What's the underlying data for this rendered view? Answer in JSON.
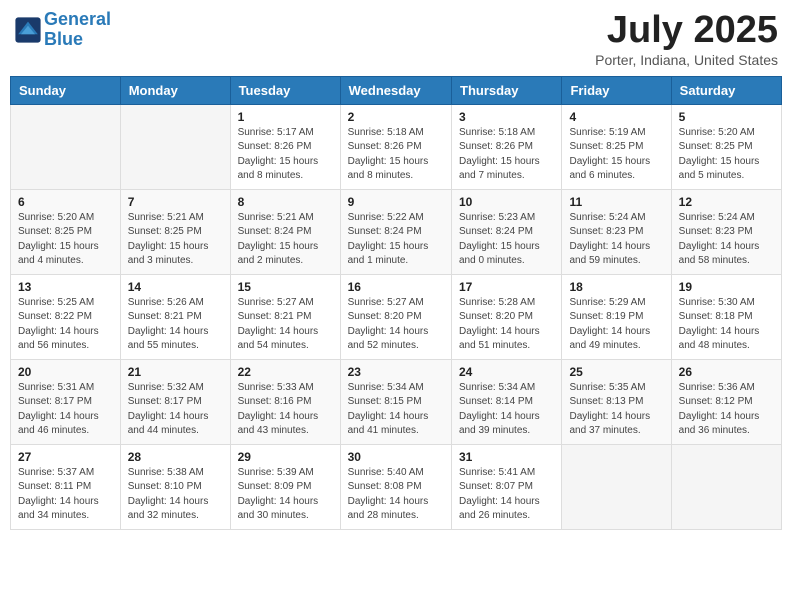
{
  "logo": {
    "line1": "General",
    "line2": "Blue"
  },
  "title": "July 2025",
  "location": "Porter, Indiana, United States",
  "weekdays": [
    "Sunday",
    "Monday",
    "Tuesday",
    "Wednesday",
    "Thursday",
    "Friday",
    "Saturday"
  ],
  "weeks": [
    [
      {
        "day": "",
        "info": ""
      },
      {
        "day": "",
        "info": ""
      },
      {
        "day": "1",
        "info": "Sunrise: 5:17 AM\nSunset: 8:26 PM\nDaylight: 15 hours\nand 8 minutes."
      },
      {
        "day": "2",
        "info": "Sunrise: 5:18 AM\nSunset: 8:26 PM\nDaylight: 15 hours\nand 8 minutes."
      },
      {
        "day": "3",
        "info": "Sunrise: 5:18 AM\nSunset: 8:26 PM\nDaylight: 15 hours\nand 7 minutes."
      },
      {
        "day": "4",
        "info": "Sunrise: 5:19 AM\nSunset: 8:25 PM\nDaylight: 15 hours\nand 6 minutes."
      },
      {
        "day": "5",
        "info": "Sunrise: 5:20 AM\nSunset: 8:25 PM\nDaylight: 15 hours\nand 5 minutes."
      }
    ],
    [
      {
        "day": "6",
        "info": "Sunrise: 5:20 AM\nSunset: 8:25 PM\nDaylight: 15 hours\nand 4 minutes."
      },
      {
        "day": "7",
        "info": "Sunrise: 5:21 AM\nSunset: 8:25 PM\nDaylight: 15 hours\nand 3 minutes."
      },
      {
        "day": "8",
        "info": "Sunrise: 5:21 AM\nSunset: 8:24 PM\nDaylight: 15 hours\nand 2 minutes."
      },
      {
        "day": "9",
        "info": "Sunrise: 5:22 AM\nSunset: 8:24 PM\nDaylight: 15 hours\nand 1 minute."
      },
      {
        "day": "10",
        "info": "Sunrise: 5:23 AM\nSunset: 8:24 PM\nDaylight: 15 hours\nand 0 minutes."
      },
      {
        "day": "11",
        "info": "Sunrise: 5:24 AM\nSunset: 8:23 PM\nDaylight: 14 hours\nand 59 minutes."
      },
      {
        "day": "12",
        "info": "Sunrise: 5:24 AM\nSunset: 8:23 PM\nDaylight: 14 hours\nand 58 minutes."
      }
    ],
    [
      {
        "day": "13",
        "info": "Sunrise: 5:25 AM\nSunset: 8:22 PM\nDaylight: 14 hours\nand 56 minutes."
      },
      {
        "day": "14",
        "info": "Sunrise: 5:26 AM\nSunset: 8:21 PM\nDaylight: 14 hours\nand 55 minutes."
      },
      {
        "day": "15",
        "info": "Sunrise: 5:27 AM\nSunset: 8:21 PM\nDaylight: 14 hours\nand 54 minutes."
      },
      {
        "day": "16",
        "info": "Sunrise: 5:27 AM\nSunset: 8:20 PM\nDaylight: 14 hours\nand 52 minutes."
      },
      {
        "day": "17",
        "info": "Sunrise: 5:28 AM\nSunset: 8:20 PM\nDaylight: 14 hours\nand 51 minutes."
      },
      {
        "day": "18",
        "info": "Sunrise: 5:29 AM\nSunset: 8:19 PM\nDaylight: 14 hours\nand 49 minutes."
      },
      {
        "day": "19",
        "info": "Sunrise: 5:30 AM\nSunset: 8:18 PM\nDaylight: 14 hours\nand 48 minutes."
      }
    ],
    [
      {
        "day": "20",
        "info": "Sunrise: 5:31 AM\nSunset: 8:17 PM\nDaylight: 14 hours\nand 46 minutes."
      },
      {
        "day": "21",
        "info": "Sunrise: 5:32 AM\nSunset: 8:17 PM\nDaylight: 14 hours\nand 44 minutes."
      },
      {
        "day": "22",
        "info": "Sunrise: 5:33 AM\nSunset: 8:16 PM\nDaylight: 14 hours\nand 43 minutes."
      },
      {
        "day": "23",
        "info": "Sunrise: 5:34 AM\nSunset: 8:15 PM\nDaylight: 14 hours\nand 41 minutes."
      },
      {
        "day": "24",
        "info": "Sunrise: 5:34 AM\nSunset: 8:14 PM\nDaylight: 14 hours\nand 39 minutes."
      },
      {
        "day": "25",
        "info": "Sunrise: 5:35 AM\nSunset: 8:13 PM\nDaylight: 14 hours\nand 37 minutes."
      },
      {
        "day": "26",
        "info": "Sunrise: 5:36 AM\nSunset: 8:12 PM\nDaylight: 14 hours\nand 36 minutes."
      }
    ],
    [
      {
        "day": "27",
        "info": "Sunrise: 5:37 AM\nSunset: 8:11 PM\nDaylight: 14 hours\nand 34 minutes."
      },
      {
        "day": "28",
        "info": "Sunrise: 5:38 AM\nSunset: 8:10 PM\nDaylight: 14 hours\nand 32 minutes."
      },
      {
        "day": "29",
        "info": "Sunrise: 5:39 AM\nSunset: 8:09 PM\nDaylight: 14 hours\nand 30 minutes."
      },
      {
        "day": "30",
        "info": "Sunrise: 5:40 AM\nSunset: 8:08 PM\nDaylight: 14 hours\nand 28 minutes."
      },
      {
        "day": "31",
        "info": "Sunrise: 5:41 AM\nSunset: 8:07 PM\nDaylight: 14 hours\nand 26 minutes."
      },
      {
        "day": "",
        "info": ""
      },
      {
        "day": "",
        "info": ""
      }
    ]
  ]
}
